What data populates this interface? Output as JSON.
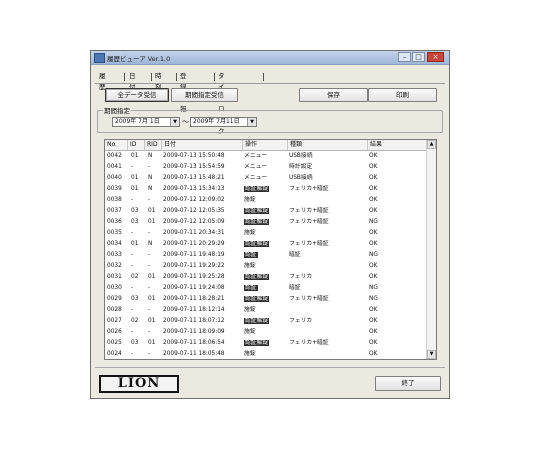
{
  "window": {
    "title": "履歴ビューア Ver.1.0"
  },
  "titlebar_buttons": {
    "minimize": "–",
    "maximize": "□",
    "close": "×"
  },
  "tabs": [
    {
      "label": "履歴"
    },
    {
      "label": "日付"
    },
    {
      "label": "時刻"
    },
    {
      "label": "登録情報"
    },
    {
      "label": "タイムロック"
    }
  ],
  "toolbar": {
    "all_data_label": "全データ受信",
    "period_label": "期間指定受信",
    "save_label": "保存",
    "print_label": "印刷"
  },
  "period": {
    "group_label": "期間指定",
    "start": "2009年 7月 1日",
    "end": "2009年 7月11日",
    "separator": "～"
  },
  "table": {
    "headers": [
      "No.",
      "ID",
      "RID",
      "日付",
      "操作",
      "種類",
      "結果"
    ],
    "rows": [
      {
        "no": "0042",
        "id": "01",
        "rid": "N",
        "date": "2009-07-13 15:50:48",
        "op": "メニュー",
        "op_hl": false,
        "kind": "USB接続",
        "kind_hl": false,
        "result": "OK"
      },
      {
        "no": "0041",
        "id": "-",
        "rid": "-",
        "date": "2009-07-13 15:54:59",
        "op": "メニュー",
        "op_hl": false,
        "kind": "時計設定",
        "kind_hl": false,
        "result": "OK"
      },
      {
        "no": "0040",
        "id": "01",
        "rid": "N",
        "date": "2009-07-13 15:48:21",
        "op": "メニュー",
        "op_hl": false,
        "kind": "USB接続",
        "kind_hl": false,
        "result": "OK"
      },
      {
        "no": "0039",
        "id": "01",
        "rid": "N",
        "date": "2009-07-13 15:34:13",
        "op": "認証解錠",
        "op_hl": true,
        "kind": "フェリカ+暗証",
        "kind_hl": false,
        "result": "OK"
      },
      {
        "no": "0038",
        "id": "-",
        "rid": "-",
        "date": "2009-07-12 12:09:02",
        "op": "施錠",
        "op_hl": false,
        "kind": "",
        "kind_hl": false,
        "result": "OK"
      },
      {
        "no": "0037",
        "id": "03",
        "rid": "01",
        "date": "2009-07-12 12:05:35",
        "op": "認証解錠",
        "op_hl": true,
        "kind": "フェリカ+暗証",
        "kind_hl": false,
        "result": "OK"
      },
      {
        "no": "0036",
        "id": "03",
        "rid": "01",
        "date": "2009-07-12 12:05:09",
        "op": "認証解錠",
        "op_hl": true,
        "kind": "フェリカ+暗証",
        "kind_hl": false,
        "result": "NG"
      },
      {
        "no": "0035",
        "id": "-",
        "rid": "-",
        "date": "2009-07-11 20:34:31",
        "op": "施錠",
        "op_hl": false,
        "kind": "",
        "kind_hl": false,
        "result": "OK"
      },
      {
        "no": "0034",
        "id": "01",
        "rid": "N",
        "date": "2009-07-11 20:29:29",
        "op": "認証解錠",
        "op_hl": true,
        "kind": "フェリカ+暗証",
        "kind_hl": false,
        "result": "OK"
      },
      {
        "no": "0033",
        "id": "-",
        "rid": "-",
        "date": "2009-07-11 19:48:19",
        "op": "認証",
        "op_hl": true,
        "kind": "暗証",
        "kind_hl": false,
        "result": "NG"
      },
      {
        "no": "0032",
        "id": "-",
        "rid": "-",
        "date": "2009-07-11 19:29:22",
        "op": "施錠",
        "op_hl": false,
        "kind": "",
        "kind_hl": false,
        "result": "OK"
      },
      {
        "no": "0031",
        "id": "02",
        "rid": "01",
        "date": "2009-07-11 19:25:28",
        "op": "認証解錠",
        "op_hl": true,
        "kind": "フェリカ",
        "kind_hl": false,
        "result": "OK"
      },
      {
        "no": "0030",
        "id": "-",
        "rid": "-",
        "date": "2009-07-11 19:24:08",
        "op": "認証",
        "op_hl": true,
        "kind": "暗証",
        "kind_hl": false,
        "result": "NG"
      },
      {
        "no": "0029",
        "id": "03",
        "rid": "01",
        "date": "2009-07-11 18:28:21",
        "op": "認証解錠",
        "op_hl": true,
        "kind": "フェリカ+暗証",
        "kind_hl": false,
        "result": "NG"
      },
      {
        "no": "0028",
        "id": "-",
        "rid": "-",
        "date": "2009-07-11 18:12:14",
        "op": "施錠",
        "op_hl": false,
        "kind": "",
        "kind_hl": false,
        "result": "OK"
      },
      {
        "no": "0027",
        "id": "02",
        "rid": "01",
        "date": "2009-07-11 18:07:12",
        "op": "認証解錠",
        "op_hl": true,
        "kind": "フェリカ",
        "kind_hl": false,
        "result": "OK"
      },
      {
        "no": "0026",
        "id": "-",
        "rid": "-",
        "date": "2009-07-11 18:09:09",
        "op": "施錠",
        "op_hl": false,
        "kind": "",
        "kind_hl": false,
        "result": "OK"
      },
      {
        "no": "0025",
        "id": "03",
        "rid": "01",
        "date": "2009-07-11 18:06:54",
        "op": "認証解錠",
        "op_hl": true,
        "kind": "フェリカ+暗証",
        "kind_hl": false,
        "result": "OK"
      },
      {
        "no": "0024",
        "id": "-",
        "rid": "-",
        "date": "2009-07-11 18:05:48",
        "op": "施錠",
        "op_hl": false,
        "kind": "",
        "kind_hl": false,
        "result": "OK"
      }
    ]
  },
  "footer": {
    "logo": "LION",
    "exit_label": "終了"
  },
  "colors": {
    "window_bg": "#ece9e1",
    "titlebar": "#9fb6d7",
    "highlight": "#2d2d2d"
  }
}
